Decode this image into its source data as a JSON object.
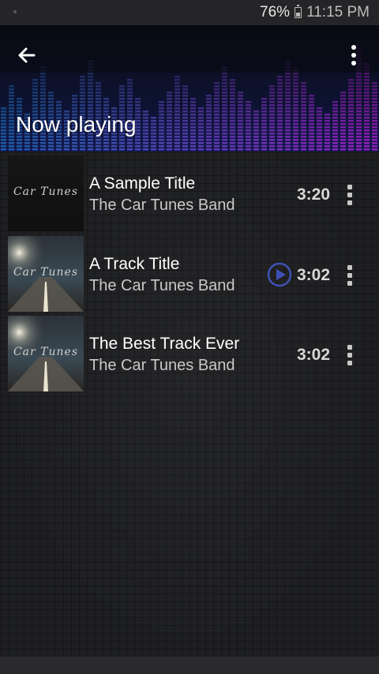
{
  "status_bar": {
    "battery": "76%",
    "time": "11:15 PM"
  },
  "header": {
    "title": "Now playing",
    "back_icon": "arrow-left-icon",
    "menu_icon": "more-vert-icon"
  },
  "tracks": [
    {
      "title": "A Sample Title",
      "artist": "The Car Tunes Band",
      "duration": "3:20",
      "art_text": "Car Tunes",
      "playing": false
    },
    {
      "title": "A Track Title",
      "artist": "The Car Tunes Band",
      "duration": "3:02",
      "art_text": "Car Tunes",
      "playing": true
    },
    {
      "title": "The Best Track Ever",
      "artist": "The Car Tunes Band",
      "duration": "3:02",
      "art_text": "Car Tunes",
      "playing": false
    }
  ],
  "colors": {
    "accent": "#3f51b5",
    "background": "#1e1f21"
  }
}
